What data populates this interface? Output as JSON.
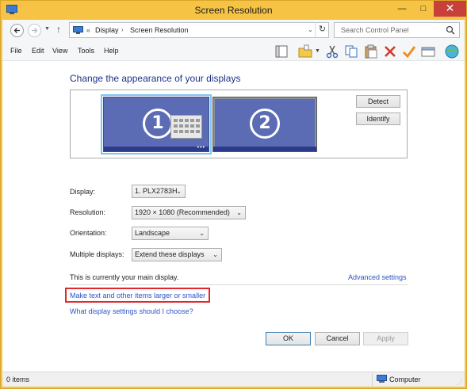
{
  "window": {
    "title": "Screen Resolution",
    "minimize": "—",
    "maximize": "□",
    "close": "✕"
  },
  "nav": {
    "breadcrumb_prefix": "«",
    "breadcrumbs": [
      "Display",
      "Screen Resolution"
    ],
    "breadcrumb_sep": "›",
    "search_placeholder": "Search Control Panel"
  },
  "menu": [
    "File",
    "Edit",
    "View",
    "Tools",
    "Help"
  ],
  "toolbar_icons": [
    "properties-icon",
    "folder-options-icon",
    "cut-icon",
    "copy-icon",
    "paste-icon",
    "delete-icon",
    "check-icon",
    "window-icon",
    "globe-icon"
  ],
  "main": {
    "heading": "Change the appearance of your displays",
    "monitors": [
      {
        "number": "1",
        "selected": true
      },
      {
        "number": "2",
        "selected": false
      }
    ],
    "detect_label": "Detect",
    "identify_label": "Identify",
    "display_label": "Display:",
    "display_value": "1. PLX2783H",
    "resolution_label": "Resolution:",
    "resolution_value": "1920 × 1080 (Recommended)",
    "orientation_label": "Orientation:",
    "orientation_value": "Landscape",
    "multiple_label": "Multiple displays:",
    "multiple_value": "Extend these displays",
    "main_note": "This is currently your main display.",
    "advanced_link": "Advanced settings",
    "larger_link": "Make text and other items larger or smaller",
    "which_link": "What display settings should I choose?",
    "ok_label": "OK",
    "cancel_label": "Cancel",
    "apply_label": "Apply"
  },
  "status": {
    "items": "0 items",
    "location": "Computer"
  },
  "colors": {
    "titlebar": "#f7c344",
    "monitor": "#5c6cb4",
    "link": "#2b55c8",
    "heading": "#1e3287",
    "highlight": "#e3262a"
  }
}
